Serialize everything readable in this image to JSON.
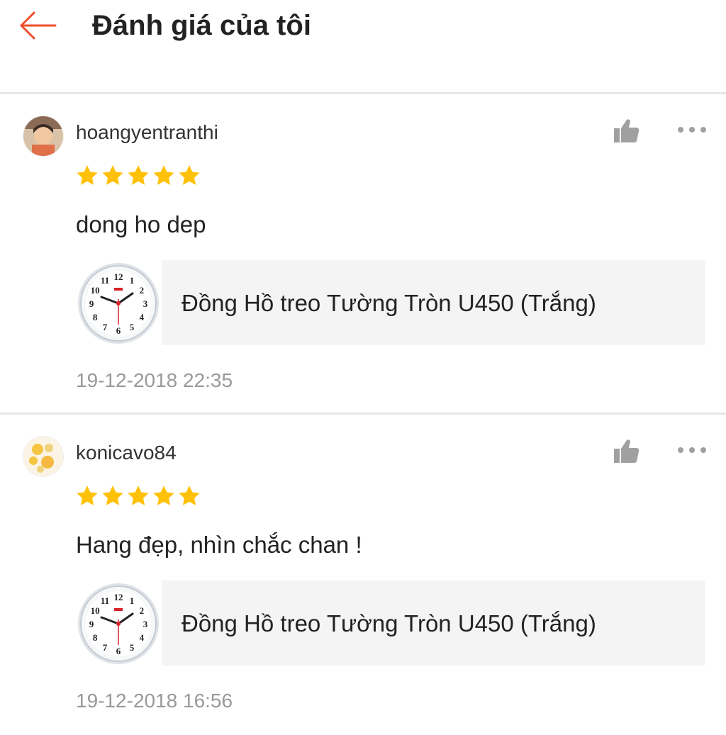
{
  "header": {
    "title": "Đánh giá của tôi",
    "back_icon": "arrow-left-icon",
    "accent": "#ee4d2d"
  },
  "reviews": [
    {
      "username": "hoangyentranthi",
      "rating": 5,
      "comment": "dong ho dep",
      "product_name": "Đồng Hồ treo Tường Tròn U450 (Trắng)",
      "timestamp": "19-12-2018 22:35"
    },
    {
      "username": "konicavo84",
      "rating": 5,
      "comment": "Hang đẹp, nhìn chắc chan !",
      "product_name": "Đồng Hồ treo Tường Tròn U450 (Trắng)",
      "timestamp": "19-12-2018 16:56"
    }
  ],
  "clock_numbers": [
    "12",
    "1",
    "2",
    "3",
    "4",
    "5",
    "6",
    "7",
    "8",
    "9",
    "10",
    "11"
  ],
  "colors": {
    "star": "#ffc107",
    "icon_gray": "#a0a0a0",
    "timestamp": "#999999"
  }
}
